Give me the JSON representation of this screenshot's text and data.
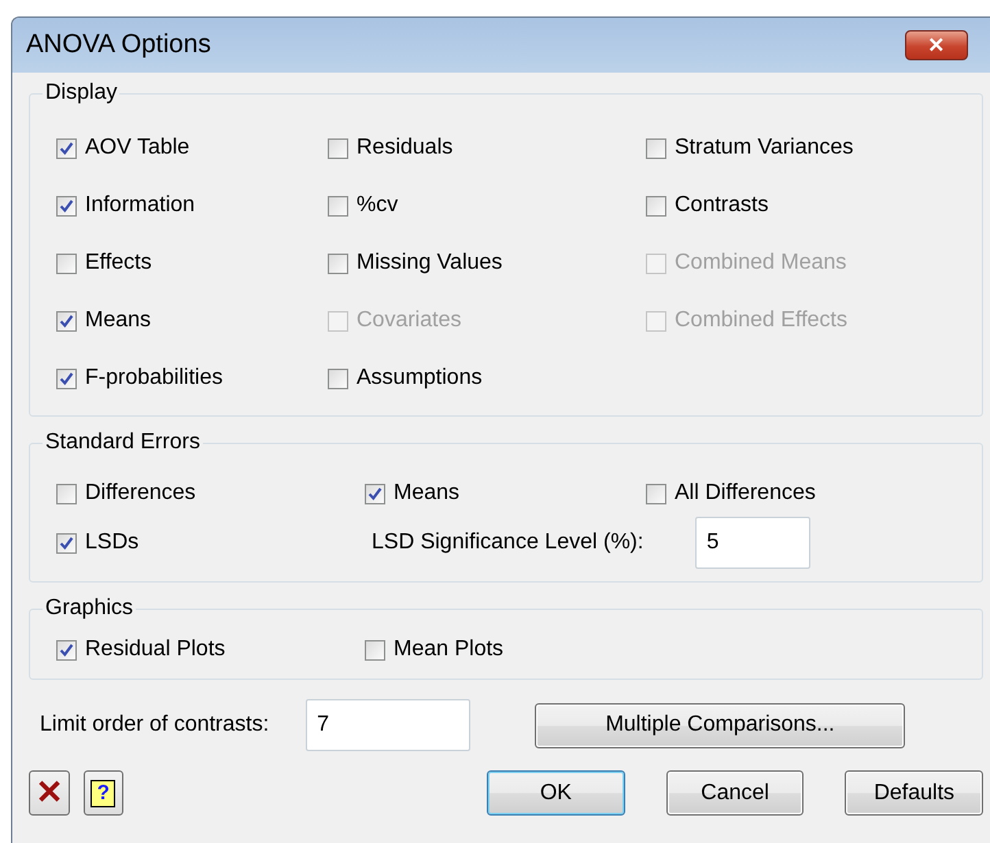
{
  "window": {
    "title": "ANOVA Options",
    "close": "✕"
  },
  "display": {
    "legend": "Display",
    "items": [
      {
        "label": "AOV Table",
        "checked": true,
        "disabled": false
      },
      {
        "label": "Residuals",
        "checked": false,
        "disabled": false
      },
      {
        "label": "Stratum Variances",
        "checked": false,
        "disabled": false
      },
      {
        "label": "Information",
        "checked": true,
        "disabled": false
      },
      {
        "label": "%cv",
        "checked": false,
        "disabled": false
      },
      {
        "label": "Contrasts",
        "checked": false,
        "disabled": false
      },
      {
        "label": "Effects",
        "checked": false,
        "disabled": false
      },
      {
        "label": "Missing Values",
        "checked": false,
        "disabled": false
      },
      {
        "label": "Combined Means",
        "checked": false,
        "disabled": true
      },
      {
        "label": "Means",
        "checked": true,
        "disabled": false
      },
      {
        "label": "Covariates",
        "checked": false,
        "disabled": true
      },
      {
        "label": "Combined Effects",
        "checked": false,
        "disabled": true
      },
      {
        "label": "F-probabilities",
        "checked": true,
        "disabled": false
      },
      {
        "label": "Assumptions",
        "checked": false,
        "disabled": false
      }
    ]
  },
  "standard_errors": {
    "legend": "Standard Errors",
    "items": [
      {
        "label": "Differences",
        "checked": false
      },
      {
        "label": "Means",
        "checked": true
      },
      {
        "label": "All Differences",
        "checked": false
      },
      {
        "label": "LSDs",
        "checked": true
      }
    ],
    "lsd_level": {
      "label": "LSD Significance Level (%):",
      "value": "5"
    }
  },
  "graphics": {
    "legend": "Graphics",
    "items": [
      {
        "label": "Residual Plots",
        "checked": true
      },
      {
        "label": "Mean Plots",
        "checked": false
      }
    ]
  },
  "limit_order": {
    "label": "Limit order of contrasts:",
    "value": "7"
  },
  "multiple_comparisons": "Multiple Comparisons...",
  "icon_buttons": [
    {
      "kind": "cancel",
      "glyph": "✕"
    },
    {
      "kind": "help",
      "glyph": "?"
    }
  ],
  "buttons": [
    {
      "label": "OK",
      "default": true
    },
    {
      "label": "Cancel",
      "default": false
    },
    {
      "label": "Defaults",
      "default": false
    }
  ]
}
